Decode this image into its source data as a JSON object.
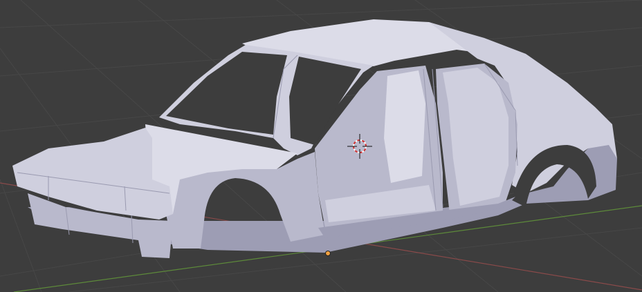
{
  "viewport": {
    "background_color": "#3d3d3d",
    "grid_color": "#474747",
    "x_axis_color": "#8a4a4a",
    "y_axis_color": "#5d8a3a",
    "model_color": "#b9b9cc",
    "cursor_color": "#d03030",
    "origin_color": "#f0a040"
  },
  "icons": {
    "cursor": "3d-cursor-icon",
    "origin": "object-origin-icon"
  }
}
